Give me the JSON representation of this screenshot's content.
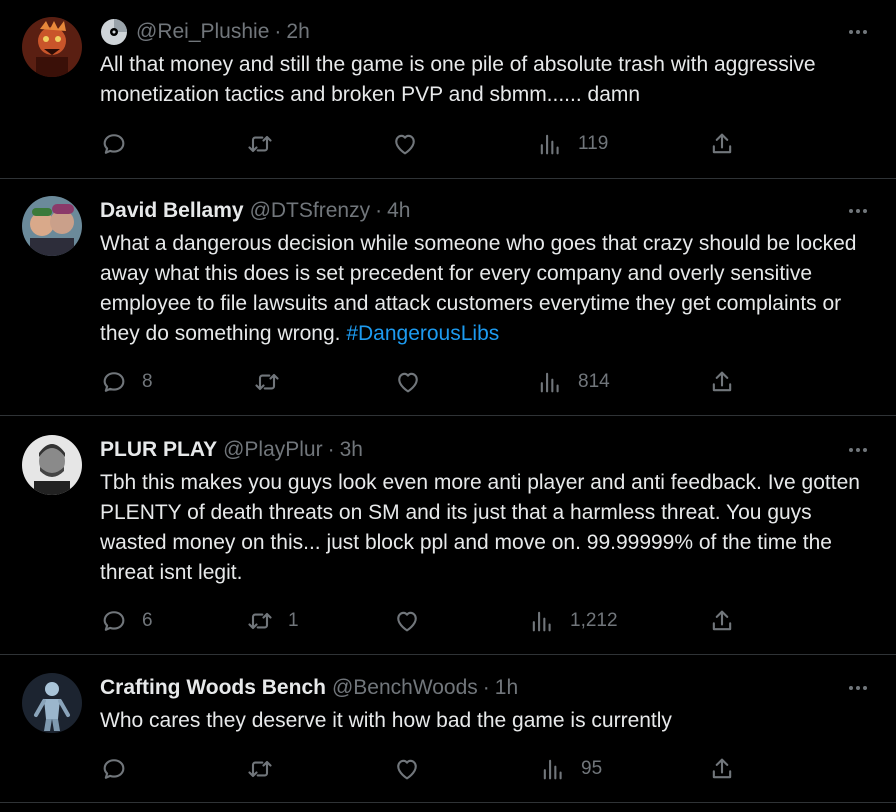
{
  "tweets": [
    {
      "display_name": "",
      "handle": "@Rei_Plushie",
      "time": "2h",
      "badge_icon": "cd-icon",
      "text": "All that money and still the game is one pile of absolute trash with aggressive monetization tactics and broken PVP and sbmm...... damn",
      "hashtag": "",
      "replies": "",
      "retweets": "",
      "likes": "",
      "views": "119"
    },
    {
      "display_name": "David Bellamy",
      "handle": "@DTSfrenzy",
      "time": "4h",
      "text": "What a dangerous decision while someone who goes that crazy should be locked away what this does is set precedent for every company and overly sensitive employee to file lawsuits and attack customers everytime they get complaints or they do something wrong. ",
      "hashtag": "#DangerousLibs",
      "replies": "8",
      "retweets": "",
      "likes": "",
      "views": "814"
    },
    {
      "display_name": "PLUR PLAY",
      "handle": "@PlayPlur",
      "time": "3h",
      "text": "Tbh this makes you guys look even more anti player and anti feedback. Ive gotten PLENTY of death threats on SM and its just that a harmless threat. You guys wasted money on this... just block ppl and move on. 99.99999% of the time the threat isnt legit.",
      "hashtag": "",
      "replies": "6",
      "retweets": "1",
      "likes": "",
      "views": "1,212"
    },
    {
      "display_name": "Crafting Woods Bench",
      "handle": "@BenchWoods",
      "time": "1h",
      "text": "Who cares they deserve it with how bad the game is currently",
      "hashtag": "",
      "replies": "",
      "retweets": "",
      "likes": "",
      "views": "95"
    }
  ],
  "separator": "·",
  "icons": {
    "reply": "reply-icon",
    "retweet": "retweet-icon",
    "like": "like-icon",
    "views": "views-icon",
    "share": "share-icon",
    "more": "more-icon"
  },
  "colors": {
    "background": "#000000",
    "text": "#e7e9ea",
    "muted": "#71767b",
    "link": "#1d9bf0",
    "divider": "#2f3336"
  }
}
